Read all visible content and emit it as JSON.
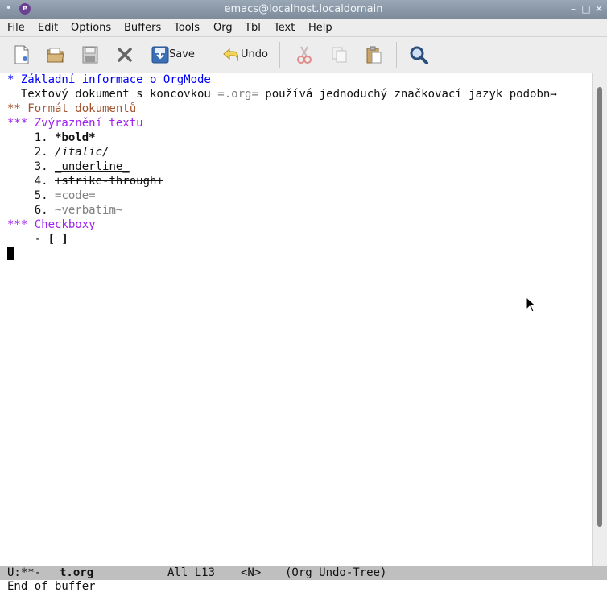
{
  "window": {
    "title": "emacs@localhost.localdomain"
  },
  "menu": [
    "File",
    "Edit",
    "Options",
    "Buffers",
    "Tools",
    "Org",
    "Tbl",
    "Text",
    "Help"
  ],
  "toolbar": {
    "save_label": "Save",
    "undo_label": "Undo"
  },
  "buffer": {
    "h1": "* Základní informace o OrgMode",
    "line2_pre": "  Textový dokument s koncovkou ",
    "line2_mark": "=.org=",
    "line2_post": " používá jednoduchý značkovací jazyk podobn",
    "line2_cont": "↦",
    "h2": "** Formát dokumentů",
    "h3a": "*** Zvýraznění textu",
    "items": [
      {
        "num": "1.",
        "text": "*bold*"
      },
      {
        "num": "2.",
        "text": "/italic/"
      },
      {
        "num": "3.",
        "text": "_underline_"
      },
      {
        "num": "4.",
        "text": "+strike-through+"
      },
      {
        "num": "5.",
        "text": "=code="
      },
      {
        "num": "6.",
        "text": "~verbatim~"
      }
    ],
    "h3b": "*** Checkboxy",
    "checkbox_dash": "- ",
    "checkbox_box": "[ ]"
  },
  "modeline": {
    "status": "U:**-",
    "filename": "t.org",
    "position": "All L13",
    "state": "<N>",
    "modes": "(Org Undo-Tree)"
  },
  "minibuffer": {
    "message": "End of buffer"
  },
  "colors": {
    "heading1": "#0000ff",
    "heading2": "#a0522d",
    "heading3": "#a020f0",
    "markup": "#808080"
  }
}
